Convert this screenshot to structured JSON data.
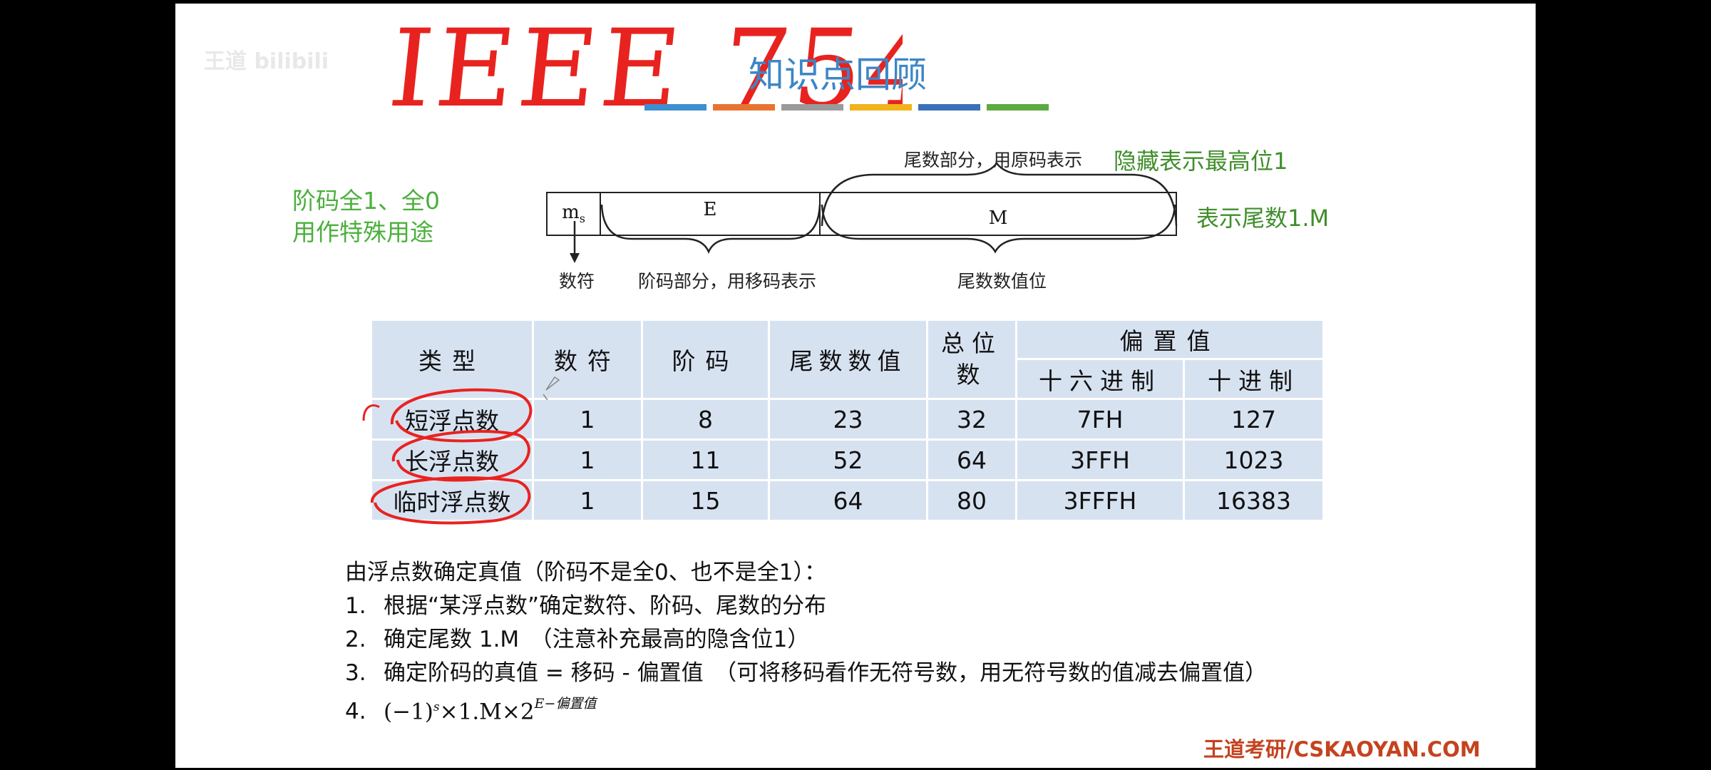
{
  "watermark": "王道 bilibili",
  "title": {
    "handwritten": "IEEE 754",
    "subtitle": "知识点回顾"
  },
  "colors": {
    "bars": [
      "#3d8fd0",
      "#e87330",
      "#9a9a9a",
      "#f1b21b",
      "#3a70b8",
      "#5bab3f"
    ],
    "annotation_red": "#e8231f",
    "note_green": "#4caf3d",
    "footer_orange": "#c4431f"
  },
  "notes": {
    "left_line1": "阶码全1、全0",
    "left_line2": "用作特殊用途",
    "hidden_bit": "隐藏表示最高位1",
    "mantissa_form": "表示尾数1.M"
  },
  "format": {
    "top_label": "尾数部分，用原码表示",
    "ms": "m",
    "ms_sub": "s",
    "e_field": "E",
    "m_field": "M",
    "sign_label": "数符",
    "exp_label": "阶码部分，用移码表示",
    "mant_label": "尾数数值位"
  },
  "table": {
    "headers": {
      "type": "类型",
      "sign": "数符",
      "exp": "阶码",
      "mantissa": "尾数数值",
      "total_1": "总位",
      "total_2": "数",
      "bias": "偏置值",
      "hex": "十六进制",
      "dec": "十进制"
    },
    "rows": [
      {
        "type": "短浮点数",
        "sign": "1",
        "exp": "8",
        "mantissa": "23",
        "total": "32",
        "hex": "7FH",
        "dec": "127"
      },
      {
        "type": "长浮点数",
        "sign": "1",
        "exp": "11",
        "mantissa": "52",
        "total": "64",
        "hex": "3FFH",
        "dec": "1023"
      },
      {
        "type": "临时浮点数",
        "sign": "1",
        "exp": "15",
        "mantissa": "64",
        "total": "80",
        "hex": "3FFFH",
        "dec": "16383"
      }
    ]
  },
  "steps": {
    "intro": "由浮点数确定真值（阶码不是全0、也不是全1）：",
    "items": [
      {
        "num": "1.",
        "text": "根据“某浮点数”确定数符、阶码、尾数的分布"
      },
      {
        "num": "2.",
        "text": "确定尾数 1.M　（注意补充最高的隐含位1）"
      },
      {
        "num": "3.",
        "text": "确定阶码的真值 = 移码 - 偏置值　（可将移码看作无符号数，用无符号数的值减去偏置值）"
      }
    ],
    "formula_num": "4.",
    "formula_main": "(−1)",
    "formula_s": "s",
    "formula_mid": "×1.M×2",
    "formula_exp": "E−偏置值"
  },
  "footer": "王道考研/CSKAOYAN.COM"
}
